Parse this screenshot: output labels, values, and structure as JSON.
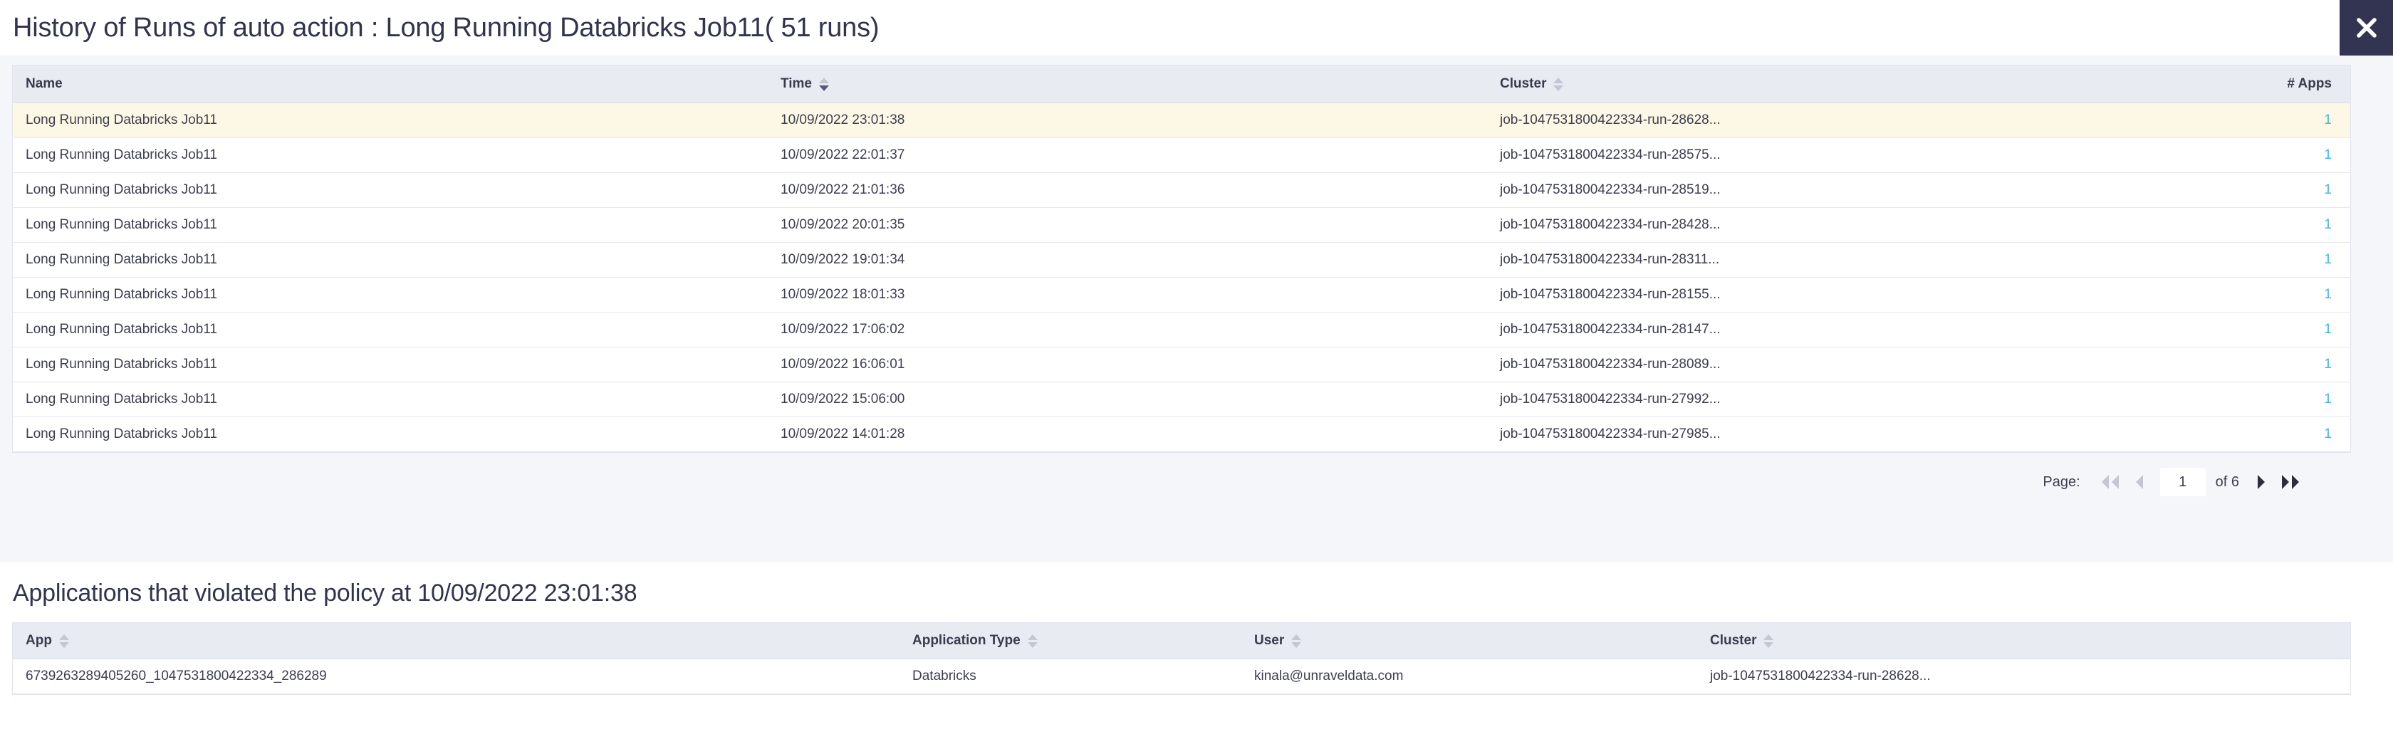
{
  "dialog": {
    "title": "History of Runs of auto action : Long Running Databricks Job11( 51 runs)",
    "close_icon": "close-icon"
  },
  "runs_table": {
    "columns": [
      {
        "label": "Name",
        "sortable": true,
        "sort": "none",
        "align": "left"
      },
      {
        "label": "Time",
        "sortable": true,
        "sort": "desc",
        "align": "left"
      },
      {
        "label": "Cluster",
        "sortable": true,
        "sort": "none",
        "align": "left"
      },
      {
        "label": "# Apps",
        "sortable": false,
        "sort": "none",
        "align": "right"
      }
    ],
    "rows": [
      {
        "name": "Long Running Databricks Job11",
        "time": "10/09/2022 23:01:38",
        "cluster": "job-1047531800422334-run-28628...",
        "apps": "1",
        "selected": true
      },
      {
        "name": "Long Running Databricks Job11",
        "time": "10/09/2022 22:01:37",
        "cluster": "job-1047531800422334-run-28575...",
        "apps": "1",
        "selected": false
      },
      {
        "name": "Long Running Databricks Job11",
        "time": "10/09/2022 21:01:36",
        "cluster": "job-1047531800422334-run-28519...",
        "apps": "1",
        "selected": false
      },
      {
        "name": "Long Running Databricks Job11",
        "time": "10/09/2022 20:01:35",
        "cluster": "job-1047531800422334-run-28428...",
        "apps": "1",
        "selected": false
      },
      {
        "name": "Long Running Databricks Job11",
        "time": "10/09/2022 19:01:34",
        "cluster": "job-1047531800422334-run-28311...",
        "apps": "1",
        "selected": false
      },
      {
        "name": "Long Running Databricks Job11",
        "time": "10/09/2022 18:01:33",
        "cluster": "job-1047531800422334-run-28155...",
        "apps": "1",
        "selected": false
      },
      {
        "name": "Long Running Databricks Job11",
        "time": "10/09/2022 17:06:02",
        "cluster": "job-1047531800422334-run-28147...",
        "apps": "1",
        "selected": false
      },
      {
        "name": "Long Running Databricks Job11",
        "time": "10/09/2022 16:06:01",
        "cluster": "job-1047531800422334-run-28089...",
        "apps": "1",
        "selected": false
      },
      {
        "name": "Long Running Databricks Job11",
        "time": "10/09/2022 15:06:00",
        "cluster": "job-1047531800422334-run-27992...",
        "apps": "1",
        "selected": false
      },
      {
        "name": "Long Running Databricks Job11",
        "time": "10/09/2022 14:01:28",
        "cluster": "job-1047531800422334-run-27985...",
        "apps": "1",
        "selected": false
      }
    ]
  },
  "pagination": {
    "label": "Page:",
    "first_icon": "double-chevron-left-icon",
    "prev_icon": "chevron-left-icon",
    "current_page": "1",
    "of_label": "of 6",
    "next_icon": "chevron-right-icon",
    "last_icon": "double-chevron-right-icon",
    "first_enabled": false,
    "prev_enabled": false,
    "next_enabled": true,
    "last_enabled": true
  },
  "apps_section": {
    "title": "Applications that violated the policy at 10/09/2022 23:01:38",
    "columns": [
      {
        "label": "App",
        "sortable": true,
        "sort": "none"
      },
      {
        "label": "Application Type",
        "sortable": true,
        "sort": "none"
      },
      {
        "label": "User",
        "sortable": true,
        "sort": "none"
      },
      {
        "label": "Cluster",
        "sortable": true,
        "sort": "none"
      }
    ],
    "rows": [
      {
        "app": "6739263289405260_1047531800422334_286289",
        "application_type": "Databricks",
        "user": "kinala@unraveldata.com",
        "cluster": "job-1047531800422334-run-28628..."
      }
    ]
  },
  "colors": {
    "header_bg": "#e9ebf3",
    "selected_row": "#fdf8e5",
    "link": "#45b6e0",
    "close_bg": "#333451",
    "page_bg": "#f5f6fa",
    "text": "#32344e"
  }
}
